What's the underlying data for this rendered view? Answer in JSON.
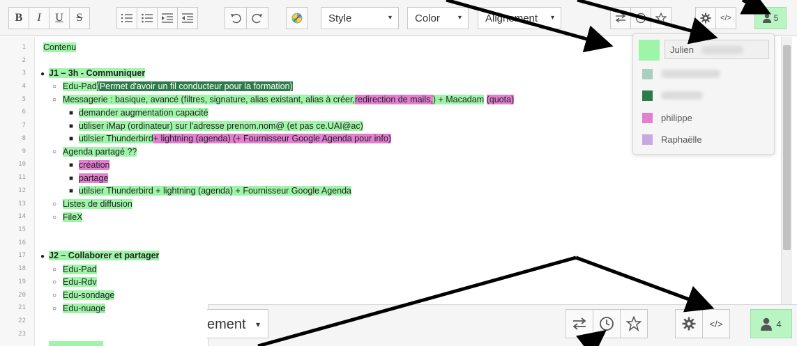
{
  "toolbar": {
    "bold": "B",
    "italic": "I",
    "underline": "U",
    "strike": "S",
    "style_label": "Style",
    "color_label": "Color",
    "align_label": "Alignement",
    "caret": "▾",
    "users_count": "5",
    "code_label": "</>"
  },
  "editor": {
    "line_numbers": [
      "1",
      "2",
      "3",
      "4",
      "5",
      "6",
      "7",
      "8",
      "9",
      "10",
      "11",
      "12",
      "13",
      "14",
      "15",
      "16",
      "17",
      "18",
      "19",
      "20",
      "21",
      "22",
      "23"
    ],
    "l1": "Contenu",
    "l3": "J1 – 3h - Communiquer",
    "l4a": "Edu-Pad",
    "l4b": "(Permet d'avoir un fil conducteur pour la formation)",
    "l5a": "Messagerie : basique, avancé (filtres, signature, alias existant, alias à créer,",
    "l5b": "redirection de mails,",
    "l5c": ") + Macadam",
    "l5d": "(quota)",
    "l6": "demander augmentation capacité",
    "l7": "utiliser iMap (ordinateur) sur l'adresse prenom.nom@ (et pas ce.UAI@ac)",
    "l8a": "utilsier Thunderbird",
    "l8b": "+ lightning (agenda) (+ Fournisseur Google Agenda pour info)",
    "l9": "Agenda partagé ??",
    "l10": "création",
    "l11": "partage",
    "l12": "utilsier Thunderbird + lightning (agenda) + Fournisseur Google Agenda",
    "l13": "Listes de diffusion",
    "l14": "FileX",
    "l17": "J2 – Collaborer et partager",
    "l18": "Edu-Pad",
    "l19": "Edu-Rdv",
    "l20": "Edu-sondage",
    "l21": "Edu-nuage"
  },
  "users_panel": {
    "current_user": "Julien",
    "users": [
      {
        "name": "",
        "color": "#a8cfc0"
      },
      {
        "name": "",
        "color": "#2d7a4a"
      },
      {
        "name": "philippe",
        "color": "#e27fd0"
      },
      {
        "name": "Raphaëlle",
        "color": "#c8a8e0"
      }
    ],
    "current_color": "#9ef5a8"
  },
  "zoom_toolbar": {
    "align_fragment": "ement",
    "caret": "▾",
    "code_label": "</>",
    "users_count": "4"
  },
  "colors": {
    "highlight_green": "#9ef5a8",
    "highlight_dark_green": "#2d7a4a",
    "highlight_pink": "#e27fd0",
    "users_button": "#b8f5c3"
  }
}
